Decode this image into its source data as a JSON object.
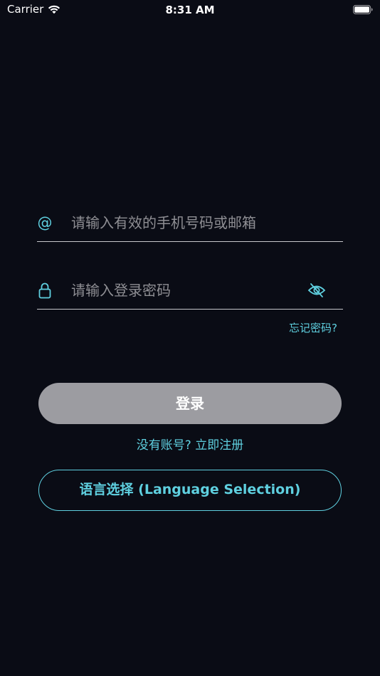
{
  "status_bar": {
    "carrier": "Carrier",
    "time": "8:31 AM",
    "icons": [
      "wifi-icon",
      "battery-icon"
    ]
  },
  "login_form": {
    "email": {
      "icon": "at-sign-icon",
      "icon_glyph": "@",
      "placeholder": "请输入有效的手机号码或邮箱",
      "value": ""
    },
    "password": {
      "icon": "lock-icon",
      "placeholder": "请输入登录密码",
      "value": "",
      "toggle_icon": "eye-slash-icon"
    },
    "forgot_password_label": "忘记密码?",
    "login_button_label": "登录",
    "register_label": "没有账号? 立即注册",
    "language_button_label": "语言选择 (Language Selection)"
  },
  "colors": {
    "background": "#0a0c15",
    "accent": "#5fd0e0",
    "button_disabled": "#9c9ca1",
    "placeholder": "#8e8e93",
    "divider": "#c8c8cc"
  }
}
